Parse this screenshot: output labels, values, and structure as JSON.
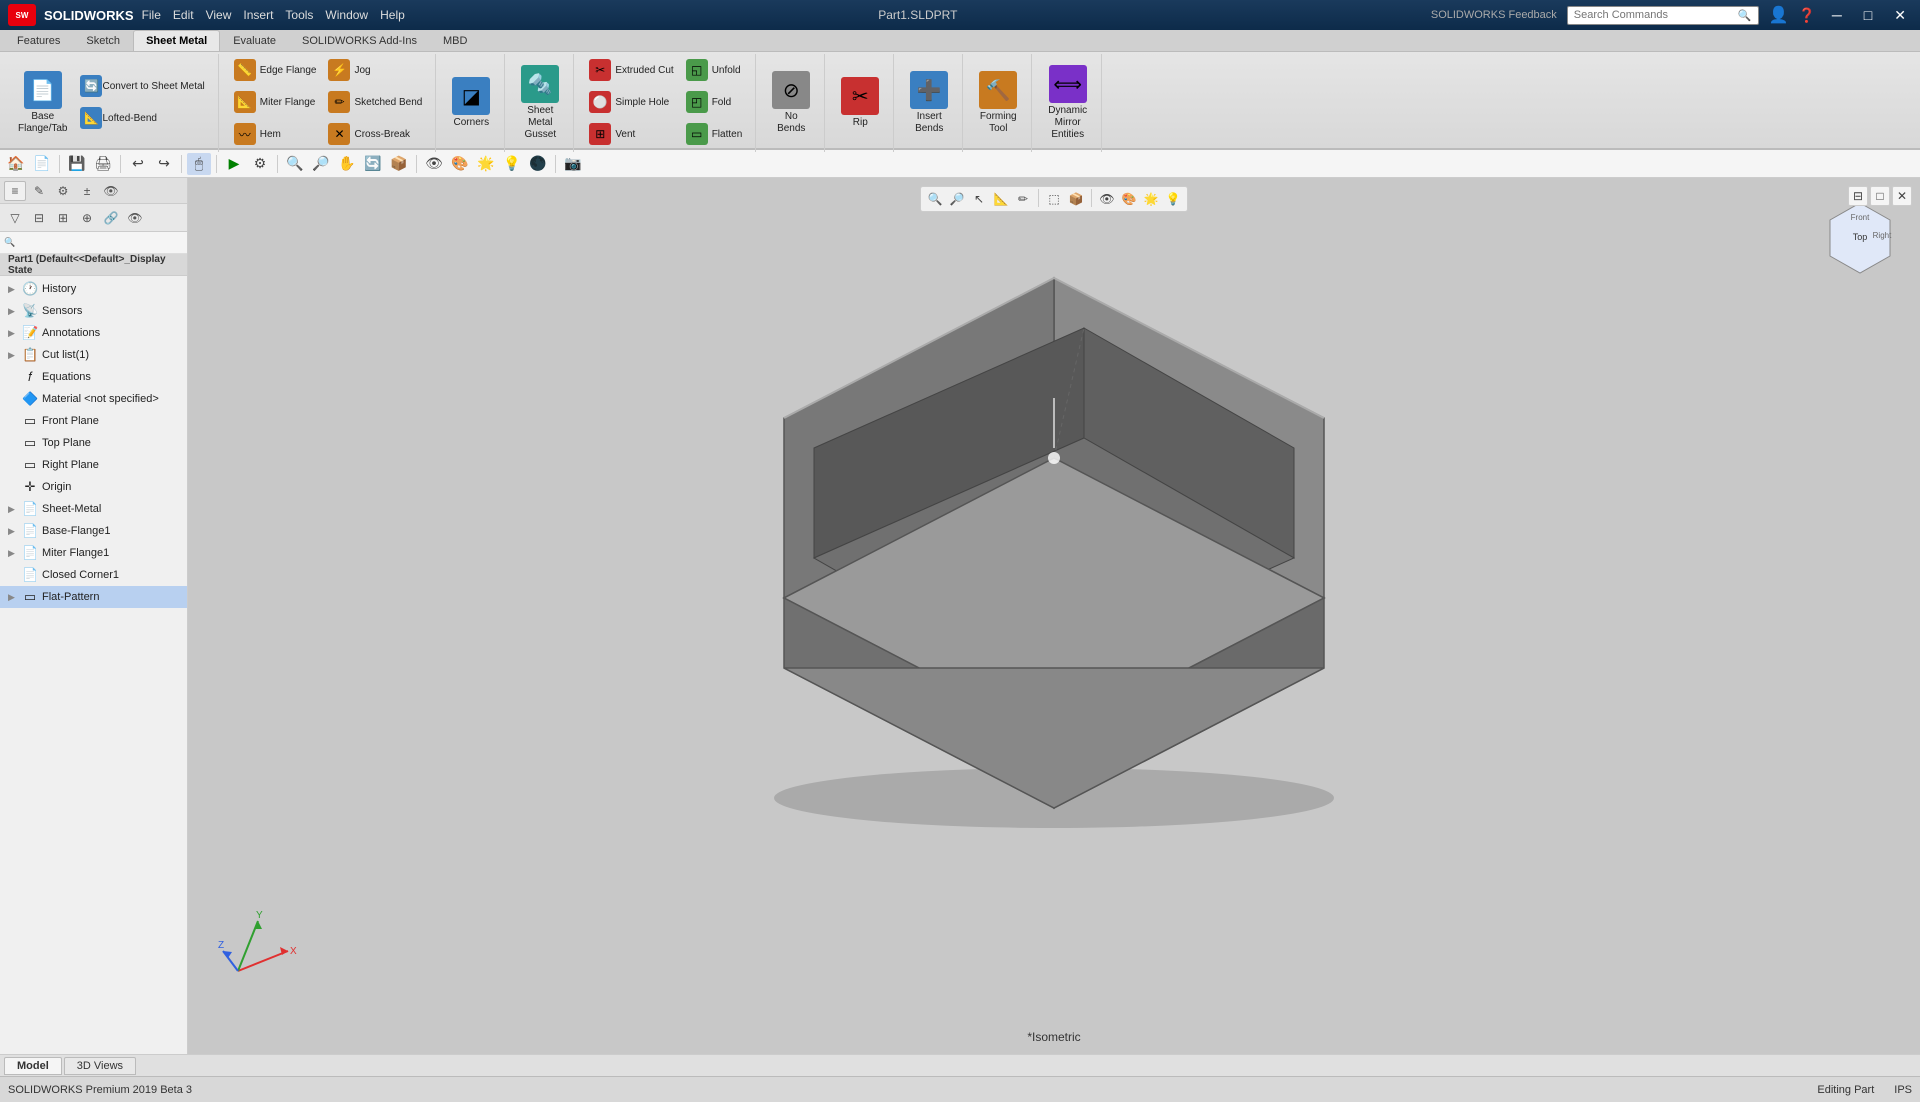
{
  "app": {
    "name": "SOLIDWORKS",
    "version": "SOLIDWORKS Premium 2019 Beta 3",
    "title": "Part1.SLDPRT",
    "full_title": "Part1.SLDPRT - SOLIDWORKS Premium 2019 Beta 3"
  },
  "menu": {
    "items": [
      "File",
      "Edit",
      "View",
      "Insert",
      "Tools",
      "Window",
      "Help"
    ]
  },
  "ribbon": {
    "tabs": [
      "Features",
      "Sketch",
      "Sheet Metal",
      "Evaluate",
      "SOLIDWORKS Add-Ins",
      "MBD"
    ],
    "active_tab": "Sheet Metal",
    "groups": [
      {
        "id": "base",
        "label": "",
        "buttons": [
          {
            "id": "base-flange",
            "label": "Base\nFlange/Tab",
            "icon": "📄",
            "color": "icon-blue"
          },
          {
            "id": "convert-sheet",
            "label": "Convert\nto Sheet\nMetal",
            "icon": "🔄",
            "color": "icon-blue"
          },
          {
            "id": "lofted-bend",
            "label": "Lofted-Bend",
            "icon": "📐",
            "color": "icon-blue"
          }
        ]
      },
      {
        "id": "bends",
        "label": "",
        "buttons": [
          {
            "id": "edge-flange",
            "label": "Edge Flange",
            "icon": "📏",
            "color": "icon-orange"
          },
          {
            "id": "miter-flange",
            "label": "Miter Flange",
            "icon": "📐",
            "color": "icon-orange"
          },
          {
            "id": "hem",
            "label": "Hem",
            "icon": "〰",
            "color": "icon-orange"
          },
          {
            "id": "jog",
            "label": "Jog",
            "icon": "⚡",
            "color": "icon-orange"
          },
          {
            "id": "sketched-bend",
            "label": "Sketched Bend",
            "icon": "✏",
            "color": "icon-orange"
          },
          {
            "id": "cross-break",
            "label": "Cross-Break",
            "icon": "✕",
            "color": "icon-orange"
          }
        ]
      },
      {
        "id": "corners",
        "label": "Corners",
        "buttons": [
          {
            "id": "corners-btn",
            "label": "Corners",
            "icon": "◪",
            "color": "icon-blue"
          }
        ]
      },
      {
        "id": "sheet-metal",
        "label": "",
        "buttons": [
          {
            "id": "sheet-metal-gusset",
            "label": "Sheet\nMetal\nGusset",
            "icon": "🔩",
            "color": "icon-teal"
          }
        ]
      },
      {
        "id": "unfold",
        "label": "",
        "buttons": [
          {
            "id": "extruded-cut",
            "label": "Extruded Cut",
            "icon": "✂",
            "color": "icon-red"
          },
          {
            "id": "simple-hole",
            "label": "Simple Hole",
            "icon": "⚪",
            "color": "icon-red"
          },
          {
            "id": "vent",
            "label": "Vent",
            "icon": "⊞",
            "color": "icon-red"
          },
          {
            "id": "unfold",
            "label": "Unfold",
            "icon": "◱",
            "color": "icon-green"
          },
          {
            "id": "fold",
            "label": "Fold",
            "icon": "◰",
            "color": "icon-green"
          },
          {
            "id": "flatten",
            "label": "Flatten",
            "icon": "▭",
            "color": "icon-green"
          }
        ]
      },
      {
        "id": "no-bends",
        "label": "",
        "buttons": [
          {
            "id": "no-bends",
            "label": "No\nBends",
            "icon": "⊘",
            "color": "icon-gray"
          }
        ]
      },
      {
        "id": "rip",
        "label": "",
        "buttons": [
          {
            "id": "rip",
            "label": "Rip",
            "icon": "✂",
            "color": "icon-red"
          }
        ]
      },
      {
        "id": "insert-bends",
        "label": "",
        "buttons": [
          {
            "id": "insert-bends",
            "label": "Insert\nBends",
            "icon": "➕",
            "color": "icon-blue"
          }
        ]
      },
      {
        "id": "forming-tool",
        "label": "Forming Tool",
        "buttons": [
          {
            "id": "forming-tool",
            "label": "Forming\nTool",
            "icon": "🔨",
            "color": "icon-orange"
          }
        ]
      },
      {
        "id": "dynamic-mirror",
        "label": "Dynamic mirror Entities",
        "buttons": [
          {
            "id": "dynamic-mirror",
            "label": "Dynamic\nMirror\nEntities",
            "icon": "⟺",
            "color": "icon-purple"
          }
        ]
      }
    ]
  },
  "tree": {
    "title": "Part1 (Default<<Default>_Display State",
    "items": [
      {
        "id": "history",
        "label": "History",
        "icon": "🕐",
        "indent": 1,
        "expanded": false
      },
      {
        "id": "sensors",
        "label": "Sensors",
        "icon": "📡",
        "indent": 1
      },
      {
        "id": "annotations",
        "label": "Annotations",
        "icon": "📝",
        "indent": 1
      },
      {
        "id": "cut-list",
        "label": "Cut list(1)",
        "icon": "📋",
        "indent": 1
      },
      {
        "id": "equations",
        "label": "Equations",
        "icon": "=",
        "indent": 1
      },
      {
        "id": "material",
        "label": "Material <not specified>",
        "icon": "🔷",
        "indent": 1
      },
      {
        "id": "front-plane",
        "label": "Front Plane",
        "icon": "▭",
        "indent": 1
      },
      {
        "id": "top-plane",
        "label": "Top Plane",
        "icon": "▭",
        "indent": 1
      },
      {
        "id": "right-plane",
        "label": "Right Plane",
        "icon": "▭",
        "indent": 1
      },
      {
        "id": "origin",
        "label": "Origin",
        "icon": "✛",
        "indent": 1
      },
      {
        "id": "sheet-metal",
        "label": "Sheet-Metal",
        "icon": "📄",
        "indent": 1
      },
      {
        "id": "base-flange1",
        "label": "Base-Flange1",
        "icon": "📄",
        "indent": 1
      },
      {
        "id": "miter-flange1",
        "label": "Miter Flange1",
        "icon": "📄",
        "indent": 1
      },
      {
        "id": "closed-corner1",
        "label": "Closed Corner1",
        "icon": "📄",
        "indent": 1
      },
      {
        "id": "flat-pattern",
        "label": "Flat-Pattern",
        "icon": "▭",
        "indent": 1,
        "selected": true
      }
    ]
  },
  "viewport": {
    "label": "*Isometric",
    "bg_color": "#c0c0c0"
  },
  "status_bar": {
    "app_info": "SOLIDWORKS Premium 2019 Beta 3",
    "editing": "Editing Part",
    "units": "IPS"
  },
  "search": {
    "placeholder": "Search Commands"
  },
  "toolbar_icons": [
    "🏠",
    "📄",
    "💾",
    "🖨",
    "↩",
    "↪",
    "🖱",
    "🔧",
    "📊",
    "⚙"
  ],
  "view_icons": [
    "🔍",
    "🔎",
    "👆",
    "📐",
    "✏",
    "🔲",
    "📦",
    "👁",
    "🎨",
    "📷",
    "🖥"
  ]
}
